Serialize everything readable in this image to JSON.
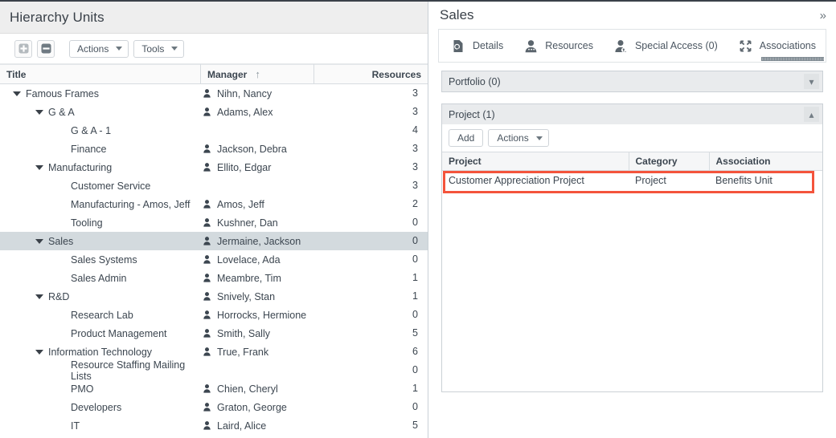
{
  "left": {
    "title": "Hierarchy Units",
    "toolbar": {
      "expand_all_icon": "plus-square-icon",
      "collapse_all_icon": "minus-square-icon",
      "actions_label": "Actions",
      "tools_label": "Tools"
    },
    "columns": {
      "title": "Title",
      "manager": "Manager",
      "manager_sort": "↑",
      "resources": "Resources"
    },
    "rows": [
      {
        "title": "Famous Frames",
        "indent": 0,
        "twisty": true,
        "manager": "Nihn, Nancy",
        "resources": "3",
        "selected": false
      },
      {
        "title": "G & A",
        "indent": 1,
        "twisty": true,
        "manager": "Adams, Alex",
        "resources": "3",
        "selected": false
      },
      {
        "title": "G & A - 1",
        "indent": 2,
        "twisty": false,
        "manager": "",
        "resources": "4",
        "selected": false
      },
      {
        "title": "Finance",
        "indent": 2,
        "twisty": false,
        "manager": "Jackson, Debra",
        "resources": "3",
        "selected": false
      },
      {
        "title": "Manufacturing",
        "indent": 1,
        "twisty": true,
        "manager": "Ellito, Edgar",
        "resources": "3",
        "selected": false
      },
      {
        "title": "Customer Service",
        "indent": 2,
        "twisty": false,
        "manager": "",
        "resources": "3",
        "selected": false
      },
      {
        "title": "Manufacturing - Amos, Jeff",
        "indent": 2,
        "twisty": false,
        "manager": "Amos, Jeff",
        "resources": "2",
        "selected": false
      },
      {
        "title": "Tooling",
        "indent": 2,
        "twisty": false,
        "manager": "Kushner, Dan",
        "resources": "0",
        "selected": false
      },
      {
        "title": "Sales",
        "indent": 1,
        "twisty": true,
        "manager": "Jermaine, Jackson",
        "resources": "0",
        "selected": true
      },
      {
        "title": "Sales Systems",
        "indent": 2,
        "twisty": false,
        "manager": "Lovelace, Ada",
        "resources": "0",
        "selected": false
      },
      {
        "title": "Sales Admin",
        "indent": 2,
        "twisty": false,
        "manager": "Meambre, Tim",
        "resources": "1",
        "selected": false
      },
      {
        "title": "R&D",
        "indent": 1,
        "twisty": true,
        "manager": "Snively, Stan",
        "resources": "1",
        "selected": false
      },
      {
        "title": "Research Lab",
        "indent": 2,
        "twisty": false,
        "manager": "Horrocks, Hermione",
        "resources": "0",
        "selected": false
      },
      {
        "title": "Product Management",
        "indent": 2,
        "twisty": false,
        "manager": "Smith, Sally",
        "resources": "5",
        "selected": false
      },
      {
        "title": "Information Technology",
        "indent": 1,
        "twisty": true,
        "manager": "True, Frank",
        "resources": "6",
        "selected": false
      },
      {
        "title": "Resource Staffing Mailing Lists",
        "indent": 2,
        "twisty": false,
        "manager": "",
        "resources": "0",
        "selected": false
      },
      {
        "title": "PMO",
        "indent": 2,
        "twisty": false,
        "manager": "Chien, Cheryl",
        "resources": "1",
        "selected": false
      },
      {
        "title": "Developers",
        "indent": 2,
        "twisty": false,
        "manager": "Graton, George",
        "resources": "0",
        "selected": false
      },
      {
        "title": "IT",
        "indent": 2,
        "twisty": false,
        "manager": "Laird, Alice",
        "resources": "5",
        "selected": false
      }
    ],
    "splitter_icon": "splitter-arrow-right-icon"
  },
  "right": {
    "title": "Sales",
    "collapse_panel_icon": "double-chevron-right-icon",
    "tabs": [
      {
        "label": "Details",
        "icon": "document-search-icon",
        "active": false
      },
      {
        "label": "Resources",
        "icon": "person-icon",
        "active": false
      },
      {
        "label": "Special Access (0)",
        "icon": "person-key-icon",
        "active": false
      },
      {
        "label": "Associations",
        "icon": "four-arrows-icon",
        "active": true
      }
    ],
    "portfolio_section": {
      "title": "Portfolio (0)",
      "chevron_icon": "chevron-double-down-icon",
      "collapsed": true
    },
    "project_section": {
      "title": "Project (1)",
      "chevron_icon": "chevron-double-up-icon",
      "collapsed": false,
      "add_label": "Add",
      "actions_label": "Actions",
      "columns": [
        "Project",
        "Category",
        "Association"
      ],
      "rows": [
        {
          "project": "Customer Appreciation Project",
          "category": "Project",
          "association": "Benefits Unit",
          "highlighted": true
        }
      ]
    }
  },
  "colors": {
    "highlight_border": "#f4543c",
    "selected_row_bg": "#d3dade",
    "panel_header_bg": "#e9ebed",
    "title_bar_bg": "#eeeeee",
    "text": "#3c4650"
  }
}
